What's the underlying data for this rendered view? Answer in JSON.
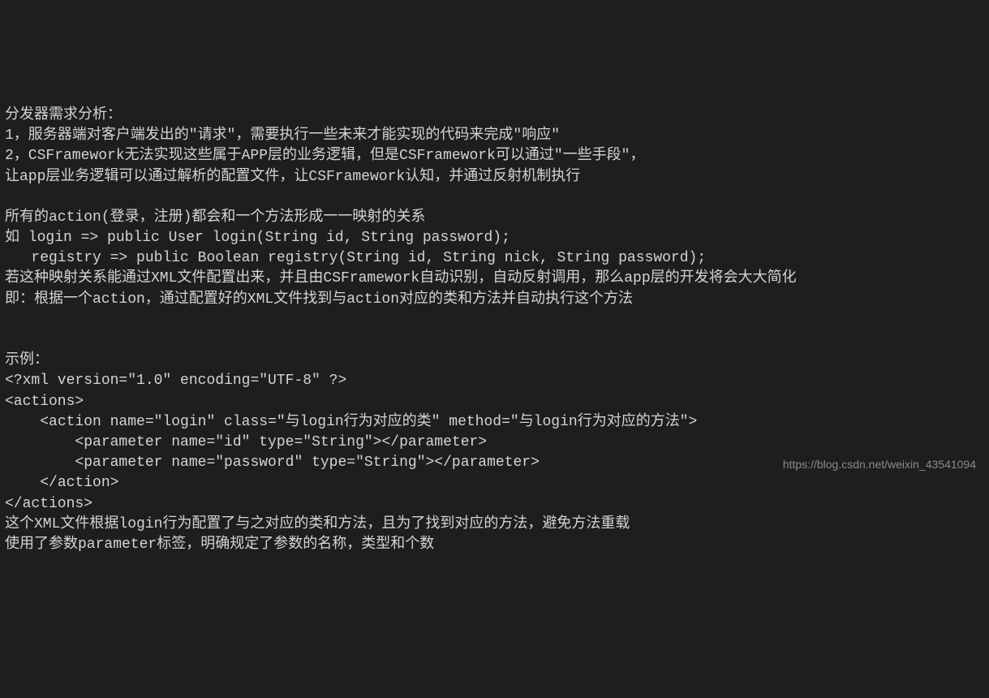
{
  "lines": [
    "分发器需求分析：",
    "1，服务器端对客户端发出的\"请求\"，需要执行一些未来才能实现的代码来完成\"响应\"",
    "2，CSFramework无法实现这些属于APP层的业务逻辑，但是CSFramework可以通过\"一些手段\"，",
    "让app层业务逻辑可以通过解析的配置文件，让CSFramework认知，并通过反射机制执行",
    "",
    "所有的action(登录，注册)都会和一个方法形成一一映射的关系",
    "如 login => public User login(String id, String password);",
    "   registry => public Boolean registry(String id, String nick, String password);",
    "若这种映射关系能通过XML文件配置出来，并且由CSFramework自动识别，自动反射调用，那么app层的开发将会大大简化",
    "即：根据一个action，通过配置好的XML文件找到与action对应的类和方法并自动执行这个方法",
    "",
    "",
    "示例：",
    "<?xml version=\"1.0\" encoding=\"UTF-8\" ?>",
    "<actions>",
    "    <action name=\"login\" class=\"与login行为对应的类\" method=\"与login行为对应的方法\">",
    "        <parameter name=\"id\" type=\"String\"></parameter>",
    "        <parameter name=\"password\" type=\"String\"></parameter>",
    "    </action>",
    "</actions>",
    "这个XML文件根据login行为配置了与之对应的类和方法，且为了找到对应的方法，避免方法重载",
    "使用了参数parameter标签，明确规定了参数的名称，类型和个数"
  ],
  "watermark": "https://blog.csdn.net/weixin_43541094"
}
